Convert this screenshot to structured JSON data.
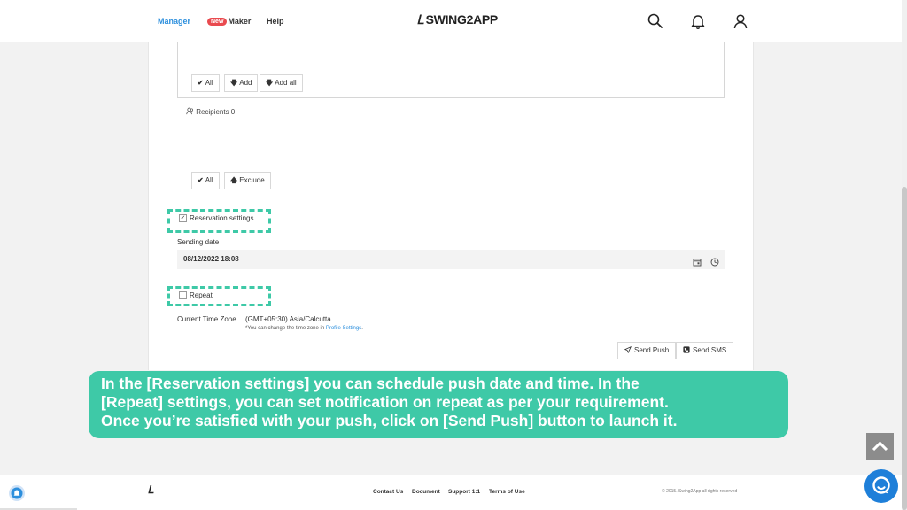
{
  "nav": {
    "manager": "Manager",
    "new_badge": "New",
    "maker": "Maker",
    "help": "Help",
    "logo_mark": "Ꮮ",
    "logo_text": "SWING2APP"
  },
  "targets": {
    "all": "All",
    "add": "Add",
    "add_all": "Add all"
  },
  "recipients": {
    "label": "Recipients 0"
  },
  "recipient_actions": {
    "all": "All",
    "exclude": "Exclude"
  },
  "reservation": {
    "checked": true,
    "label": "Reservation settings",
    "sending_date_label": "Sending date",
    "sending_date_value": "08/12/2022 18:08"
  },
  "repeat": {
    "checked": false,
    "label": "Repeat"
  },
  "timezone": {
    "label": "Current Time Zone",
    "value": "(GMT+05:30) Asia/Calcutta",
    "note": "*You can change the time zone in ",
    "link": "Profile Settings",
    "note_end": "."
  },
  "send": {
    "push": "Send Push",
    "sms": "Send SMS"
  },
  "banner": {
    "line1": "In the [Reservation settings] you can schedule push date and time. In the",
    "line2": "[Repeat] settings, you can set notification on repeat as per your requirement.",
    "line3": "Once you’re satisfied with your push, click on [Send Push] button to launch it."
  },
  "footer": {
    "logo": "Ꮮ",
    "contact": "Contact Us",
    "document": "Document",
    "support": "Support 1:1",
    "terms": "Terms of Use",
    "copyright": "© 2015. Swing2App all rights reserved"
  },
  "colors": {
    "accent": "#3ec9a7",
    "link": "#2c8fdd",
    "badge": "#e94a4f",
    "chat": "#1e7fd9"
  }
}
